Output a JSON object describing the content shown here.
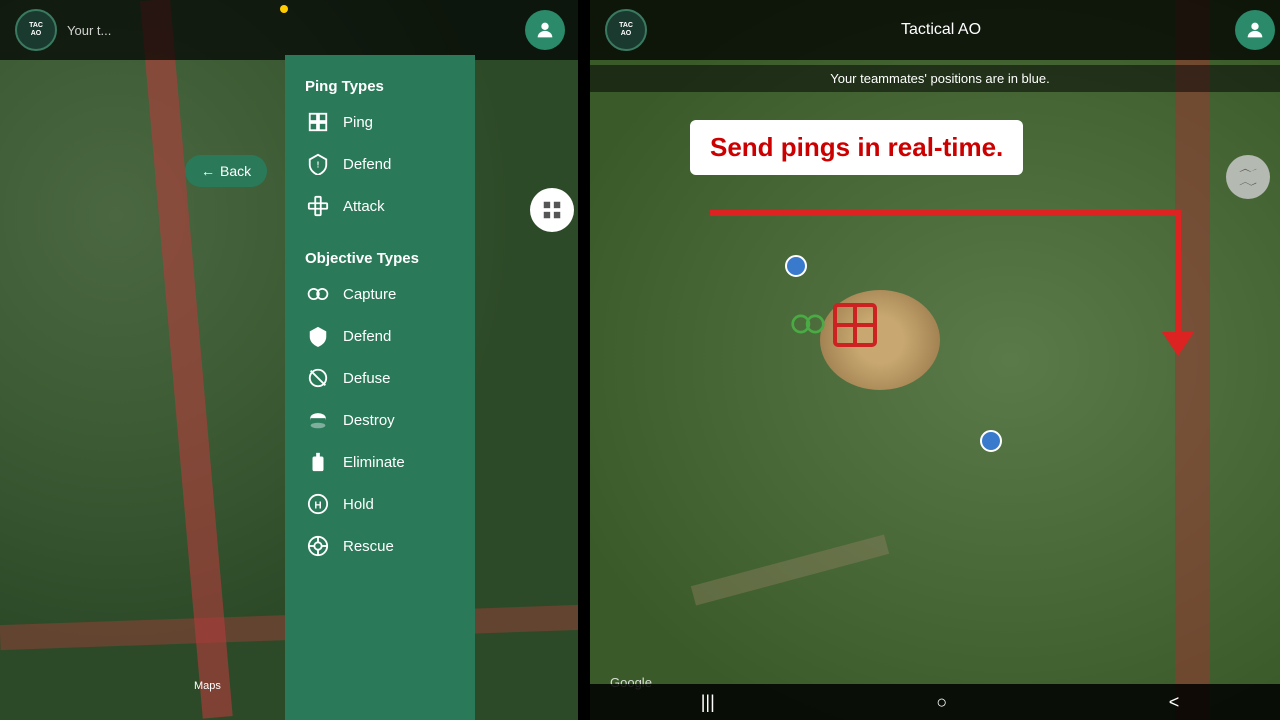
{
  "left_panel": {
    "header": {
      "logo_text": "TAC\nAO",
      "subtitle": "Your t...",
      "avatar_icon": "person"
    },
    "back_button": "Back",
    "apple_maps_label": "Maps",
    "menu": {
      "ping_types_title": "Ping Types",
      "ping_types": [
        {
          "label": "Ping",
          "icon": "⊞"
        },
        {
          "label": "Defend",
          "icon": "⚠"
        },
        {
          "label": "Attack",
          "icon": "⊞"
        }
      ],
      "objective_types_title": "Objective Types",
      "objective_types": [
        {
          "label": "Capture",
          "icon": "⛓"
        },
        {
          "label": "Defend",
          "icon": "🛡"
        },
        {
          "label": "Defuse",
          "icon": "🚫"
        },
        {
          "label": "Destroy",
          "icon": "💣"
        },
        {
          "label": "Eliminate",
          "icon": "✝"
        },
        {
          "label": "Hold",
          "icon": "Ⓗ"
        },
        {
          "label": "Rescue",
          "icon": "🔘"
        }
      ]
    }
  },
  "right_panel": {
    "header": {
      "logo_text": "TAC\nAO",
      "title": "Tactical AO",
      "avatar_icon": "person",
      "subtitle": "Your teammates' positions are in blue."
    },
    "google_label": "Google",
    "tooltip": {
      "text": "Send pings in real-time."
    },
    "nav": {
      "menu_icon": "|||",
      "home_icon": "○",
      "back_icon": "<"
    }
  },
  "colors": {
    "teal": "#2a7a5a",
    "red_arrow": "#dd2222",
    "blue_dot": "#3a7acc",
    "tooltip_text": "#cc0000",
    "header_bg": "rgba(0,0,0,0.75)"
  }
}
